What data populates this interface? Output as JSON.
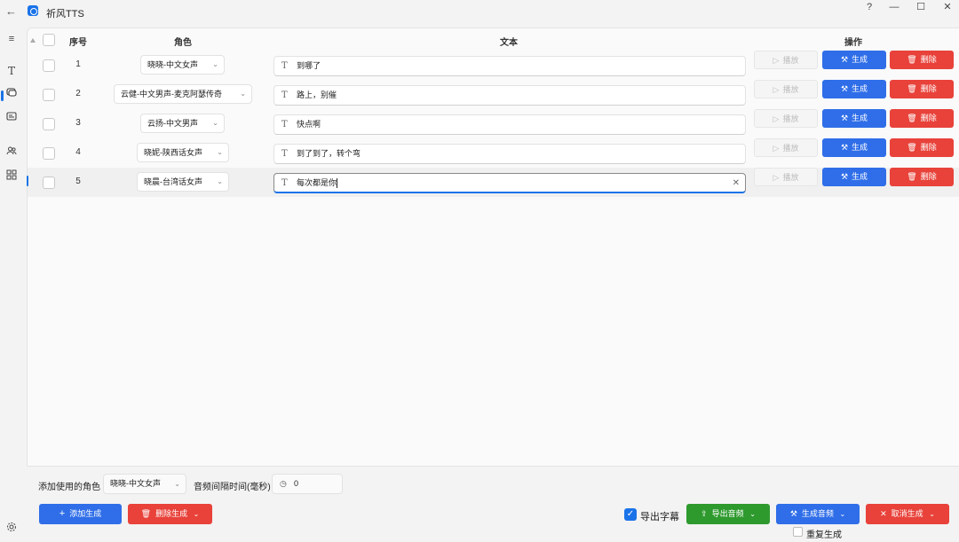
{
  "window": {
    "title": "祈风TTS",
    "controls": {
      "help": "?",
      "minimize": "—",
      "maximize": "☐",
      "close": "✕"
    }
  },
  "table": {
    "headers": {
      "index": "序号",
      "role": "角色",
      "text": "文本",
      "actions": "操作"
    },
    "rows": [
      {
        "index": "1",
        "role": "晓晓-中文女声",
        "text": "到哪了",
        "play": "播放",
        "generate": "生成",
        "delete": "删除"
      },
      {
        "index": "2",
        "role": "云健-中文男声-麦克阿瑟传奇",
        "text": "路上，别催",
        "play": "播放",
        "generate": "生成",
        "delete": "删除"
      },
      {
        "index": "3",
        "role": "云扬-中文男声",
        "text": "快点啊",
        "play": "播放",
        "generate": "生成",
        "delete": "删除"
      },
      {
        "index": "4",
        "role": "晓妮-陕西话女声",
        "text": "到了到了，转个弯",
        "play": "播放",
        "generate": "生成",
        "delete": "删除"
      },
      {
        "index": "5",
        "role": "晓晨-台湾话女声",
        "text": "每次都是你",
        "play": "播放",
        "generate": "生成",
        "delete": "删除"
      }
    ]
  },
  "footer": {
    "role_label": "添加使用的角色",
    "role_value": "晓晓-中文女声",
    "interval_label": "音频间隔时间(毫秒)",
    "interval_value": "0",
    "add_generate": "添加生成",
    "delete_generate": "删除生成",
    "export_subtitle": "导出字幕",
    "export_subtitle_checked": true,
    "export_audio": "导出音频",
    "generate_audio": "生成音频",
    "cancel_generate": "取消生成",
    "regenerate": "重复生成"
  },
  "colors": {
    "primary": "#2f6ee8",
    "danger": "#e8423a",
    "success": "#2e9a2e",
    "disabled": "#f5f5f5"
  },
  "icons": {
    "nav": [
      "menu-icon",
      "text-icon",
      "chat-icon",
      "image-icon",
      "users-icon",
      "grid-icon",
      "settings-icon"
    ]
  }
}
